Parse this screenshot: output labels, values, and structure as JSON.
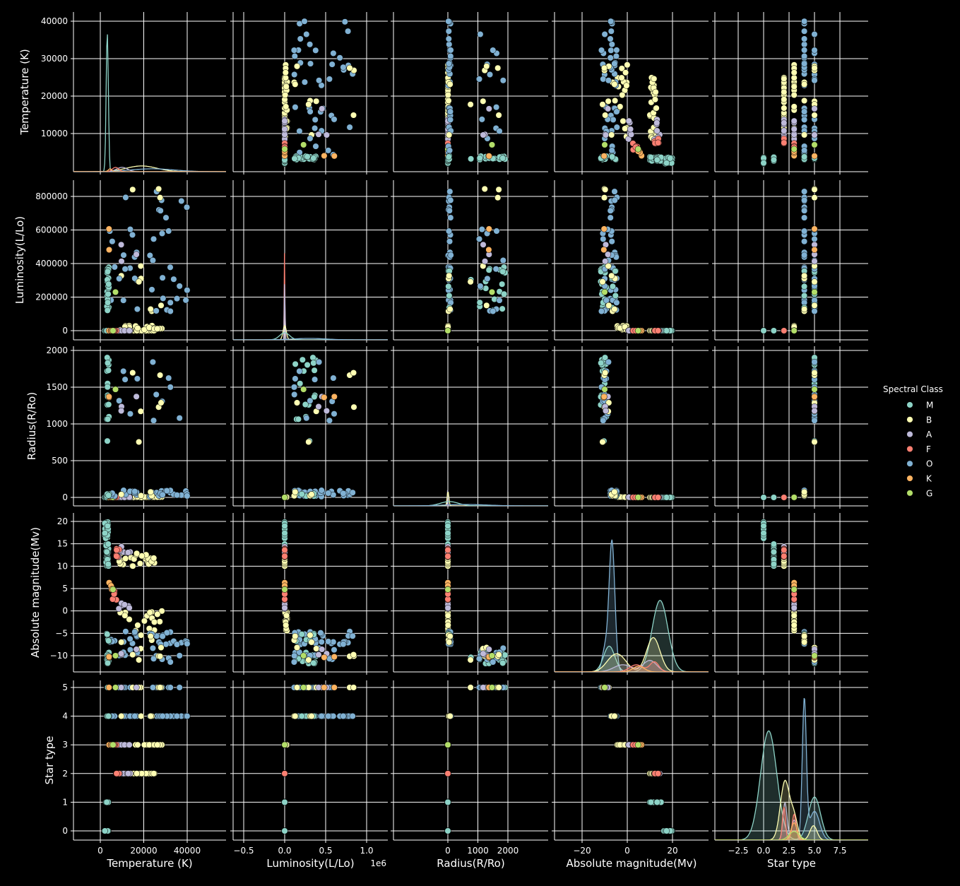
{
  "legend": {
    "title": "Spectral Class",
    "position": "right",
    "entries": [
      {
        "label": "M",
        "color": "#8dd3c7"
      },
      {
        "label": "B",
        "color": "#ffffb3"
      },
      {
        "label": "A",
        "color": "#bebada"
      },
      {
        "label": "F",
        "color": "#fb8072"
      },
      {
        "label": "O",
        "color": "#80b1d3"
      },
      {
        "label": "K",
        "color": "#fdb462"
      },
      {
        "label": "G",
        "color": "#b3de69"
      }
    ]
  },
  "chart_data": {
    "type": "scatter",
    "subtype": "pairplot",
    "grid": true,
    "hue": "Spectral Class",
    "variables": [
      {
        "key": "temp",
        "label": "Temperature (K)",
        "ticks": [
          0,
          20000,
          40000
        ],
        "tick_labels": [
          "0",
          "20000",
          "40000"
        ],
        "ylim": [
          -400,
          41500
        ],
        "ytick_labels": [
          "10000",
          "20000",
          "30000",
          "40000"
        ]
      },
      {
        "key": "lum",
        "label": "Luminosity(L/Lo)",
        "ticks": [
          -0.5,
          0,
          0.5,
          1
        ],
        "tick_labels": [
          "−0.5",
          "0.0",
          "0.5",
          "1.0"
        ],
        "offset_text": "1e6",
        "ylim": [
          -40000,
          890000
        ],
        "ytick_labels": [
          "0",
          "200000",
          "400000",
          "600000",
          "800000"
        ]
      },
      {
        "key": "rad",
        "label": "Radius(R/Ro)",
        "ticks": [
          0,
          1000,
          2000
        ],
        "tick_labels": [
          "0",
          "1000",
          "2000"
        ],
        "ylim": [
          -100,
          2050
        ],
        "ytick_labels": [
          "0",
          "500",
          "1000",
          "1500",
          "2000"
        ]
      },
      {
        "key": "mag",
        "label": "Absolute magnitude(Mv)",
        "ticks": [
          -20,
          0,
          20
        ],
        "tick_labels": [
          "−20",
          "0",
          "20"
        ],
        "ylim": [
          -12.9,
          21.5
        ],
        "ytick_labels": [
          "−10",
          "−5",
          "0",
          "5",
          "10",
          "15",
          "20"
        ]
      },
      {
        "key": "type",
        "label": "Star type",
        "ticks": [
          -2.5,
          0,
          2.5,
          5,
          7.5
        ],
        "tick_labels": [
          "−2.5",
          "0.0",
          "2.5",
          "5.0",
          "7.5"
        ],
        "ylim": [
          -0.25,
          5.25
        ],
        "ytick_labels": [
          "0",
          "1",
          "2",
          "3",
          "4",
          "5"
        ]
      }
    ],
    "groups": [
      {
        "star_type": 0,
        "class": "M",
        "n": 40,
        "temp": [
          1900,
          3600
        ],
        "lum": [
          0.0001,
          0.005
        ],
        "rad": [
          0.08,
          0.6
        ],
        "mag": [
          16,
          20
        ]
      },
      {
        "star_type": 1,
        "class": "M",
        "n": 40,
        "temp": [
          2600,
          3800
        ],
        "lum": [
          0.0001,
          0.01
        ],
        "rad": [
          0.1,
          0.9
        ],
        "mag": [
          10,
          15
        ]
      },
      {
        "star_type": 2,
        "class": "B",
        "n": 24,
        "temp": [
          8000,
          25000
        ],
        "lum": [
          0.0002,
          0.01
        ],
        "rad": [
          0.006,
          0.02
        ],
        "mag": [
          10,
          13
        ]
      },
      {
        "star_type": 2,
        "class": "A",
        "n": 10,
        "temp": [
          7200,
          14000
        ],
        "lum": [
          0.0001,
          0.003
        ],
        "rad": [
          0.008,
          0.02
        ],
        "mag": [
          11.5,
          14.5
        ]
      },
      {
        "star_type": 2,
        "class": "F",
        "n": 6,
        "temp": [
          6000,
          9000
        ],
        "lum": [
          0.0002,
          0.002
        ],
        "rad": [
          0.01,
          0.03
        ],
        "mag": [
          12,
          14
        ]
      },
      {
        "star_type": 3,
        "class": "B",
        "n": 18,
        "temp": [
          9000,
          29000
        ],
        "lum": [
          10,
          30000
        ],
        "rad": [
          1,
          7
        ],
        "mag": [
          -4.5,
          0
        ]
      },
      {
        "star_type": 3,
        "class": "A",
        "n": 6,
        "temp": [
          8000,
          14000
        ],
        "lum": [
          5,
          100
        ],
        "rad": [
          1,
          3
        ],
        "mag": [
          -1,
          2
        ]
      },
      {
        "star_type": 3,
        "class": "F",
        "n": 6,
        "temp": [
          5500,
          8000
        ],
        "lum": [
          1,
          15
        ],
        "rad": [
          0.9,
          2
        ],
        "mag": [
          1,
          6
        ]
      },
      {
        "star_type": 3,
        "class": "K",
        "n": 4,
        "temp": [
          4000,
          5500
        ],
        "lum": [
          0.3,
          1
        ],
        "rad": [
          0.7,
          1.1
        ],
        "mag": [
          4,
          6.5
        ]
      },
      {
        "star_type": 3,
        "class": "G",
        "n": 1,
        "temp": [
          5700,
          6000
        ],
        "lum": [
          1,
          1
        ],
        "rad": [
          1,
          1
        ],
        "mag": [
          4.8,
          4.8
        ]
      },
      {
        "star_type": 4,
        "class": "O",
        "n": 30,
        "temp": [
          3000,
          40000
        ],
        "lum": [
          100000,
          830000
        ],
        "rad": [
          10,
          100
        ],
        "mag": [
          -7.5,
          -4.5
        ]
      },
      {
        "star_type": 4,
        "class": "M",
        "n": 6,
        "temp": [
          3000,
          4000
        ],
        "lum": [
          100000,
          360000
        ],
        "rad": [
          10,
          90
        ],
        "mag": [
          -7,
          -5
        ]
      },
      {
        "star_type": 4,
        "class": "B",
        "n": 4,
        "temp": [
          9000,
          25000
        ],
        "lum": [
          100000,
          380000
        ],
        "rad": [
          20,
          90
        ],
        "mag": [
          -7,
          -4.5
        ]
      },
      {
        "star_type": 5,
        "class": "M",
        "n": 18,
        "temp": [
          3000,
          4000
        ],
        "lum": [
          80000,
          380000
        ],
        "rad": [
          700,
          1950
        ],
        "mag": [
          -12,
          -9
        ]
      },
      {
        "star_type": 5,
        "class": "O",
        "n": 12,
        "temp": [
          8000,
          40000
        ],
        "lum": [
          100000,
          810000
        ],
        "rad": [
          1000,
          1950
        ],
        "mag": [
          -11.5,
          -8
        ]
      },
      {
        "star_type": 5,
        "class": "B",
        "n": 6,
        "temp": [
          12000,
          28000
        ],
        "lum": [
          150000,
          850000
        ],
        "rad": [
          700,
          1780
        ],
        "mag": [
          -11,
          -8
        ]
      },
      {
        "star_type": 5,
        "class": "A",
        "n": 3,
        "temp": [
          8900,
          24000
        ],
        "lum": [
          400000,
          540000
        ],
        "rad": [
          1100,
          1500
        ],
        "mag": [
          -10,
          -8
        ]
      },
      {
        "star_type": 5,
        "class": "K",
        "n": 2,
        "temp": [
          3500,
          4500
        ],
        "lum": [
          280000,
          630000
        ],
        "rad": [
          1300,
          1500
        ],
        "mag": [
          -10.5,
          -9.5
        ]
      },
      {
        "star_type": 5,
        "class": "G",
        "n": 1,
        "temp": [
          7000,
          7000
        ],
        "lum": [
          230000,
          230000
        ],
        "rad": [
          1470,
          1470
        ],
        "mag": [
          -10,
          -10
        ]
      }
    ],
    "kde": {
      "temp": [
        {
          "class": "M",
          "mu": 3200,
          "sd": 500,
          "peak": 0.97
        },
        {
          "class": "B",
          "mu": 19000,
          "sd": 7000,
          "peak": 0.04
        },
        {
          "class": "O",
          "mu": 24000,
          "sd": 10000,
          "peak": 0.02
        },
        {
          "class": "A",
          "mu": 10000,
          "sd": 2500,
          "peak": 0.03
        },
        {
          "class": "F",
          "mu": 7000,
          "sd": 1500,
          "peak": 0.03
        },
        {
          "class": "K",
          "mu": 4500,
          "sd": 800,
          "peak": 0.02
        }
      ],
      "lum": [
        {
          "class": "F",
          "mu": 0,
          "sd": 3000,
          "peak": 0.95
        },
        {
          "class": "A",
          "mu": 0,
          "sd": 4000,
          "peak": 0.5
        },
        {
          "class": "B",
          "mu": 0,
          "sd": 20000,
          "peak": 0.1
        },
        {
          "class": "M",
          "mu": 0,
          "sd": 60000,
          "peak": 0.05
        },
        {
          "class": "O",
          "mu": 300000,
          "sd": 200000,
          "peak": 0.01
        }
      ],
      "rad": [
        {
          "class": "F",
          "mu": 1,
          "sd": 3,
          "peak": 0.95
        },
        {
          "class": "A",
          "mu": 1,
          "sd": 5,
          "peak": 0.6
        },
        {
          "class": "B",
          "mu": 5,
          "sd": 30,
          "peak": 0.1
        },
        {
          "class": "M",
          "mu": 50,
          "sd": 300,
          "peak": 0.03
        },
        {
          "class": "O",
          "mu": 600,
          "sd": 700,
          "peak": 0.01
        }
      ],
      "mag": [
        {
          "class": "O",
          "mu": -6.8,
          "sd": 1.3,
          "peak": 0.92
        },
        {
          "class": "O",
          "mu": -10,
          "sd": 1.2,
          "peak": 0.15
        },
        {
          "class": "M",
          "mu": 14.5,
          "sd": 3.5,
          "peak": 0.5
        },
        {
          "class": "M",
          "mu": -8,
          "sd": 2.5,
          "peak": 0.18
        },
        {
          "class": "B",
          "mu": 11.5,
          "sd": 3,
          "peak": 0.24
        },
        {
          "class": "B",
          "mu": -6,
          "sd": 3.5,
          "peak": 0.1
        },
        {
          "class": "B",
          "mu": -2,
          "sd": 3,
          "peak": 0.05
        },
        {
          "class": "A",
          "mu": 10,
          "sd": 3,
          "peak": 0.08
        },
        {
          "class": "A",
          "mu": -2,
          "sd": 4,
          "peak": 0.05
        },
        {
          "class": "F",
          "mu": 12,
          "sd": 2,
          "peak": 0.07
        },
        {
          "class": "F",
          "mu": 4,
          "sd": 3,
          "peak": 0.05
        },
        {
          "class": "K",
          "mu": 5,
          "sd": 2.5,
          "peak": 0.04
        }
      ],
      "type": [
        {
          "class": "M",
          "mu": 0.5,
          "sd": 0.8,
          "peak": 0.76
        },
        {
          "class": "M",
          "mu": 5,
          "sd": 0.6,
          "peak": 0.3
        },
        {
          "class": "O",
          "mu": 4,
          "sd": 0.2,
          "peak": 0.97
        },
        {
          "class": "O",
          "mu": 5,
          "sd": 0.5,
          "peak": 0.2
        },
        {
          "class": "B",
          "mu": 2.1,
          "sd": 0.45,
          "peak": 0.41
        },
        {
          "class": "B",
          "mu": 3,
          "sd": 0.35,
          "peak": 0.15
        },
        {
          "class": "B",
          "mu": 4.9,
          "sd": 0.35,
          "peak": 0.1
        },
        {
          "class": "A",
          "mu": 2.1,
          "sd": 0.2,
          "peak": 0.26
        },
        {
          "class": "A",
          "mu": 3,
          "sd": 0.25,
          "peak": 0.14
        },
        {
          "class": "F",
          "mu": 2,
          "sd": 0.15,
          "peak": 0.23
        },
        {
          "class": "F",
          "mu": 3,
          "sd": 0.2,
          "peak": 0.18
        },
        {
          "class": "K",
          "mu": 3,
          "sd": 0.3,
          "peak": 0.12
        },
        {
          "class": "G",
          "mu": 3,
          "sd": 0.5,
          "peak": 0.06
        }
      ]
    }
  }
}
